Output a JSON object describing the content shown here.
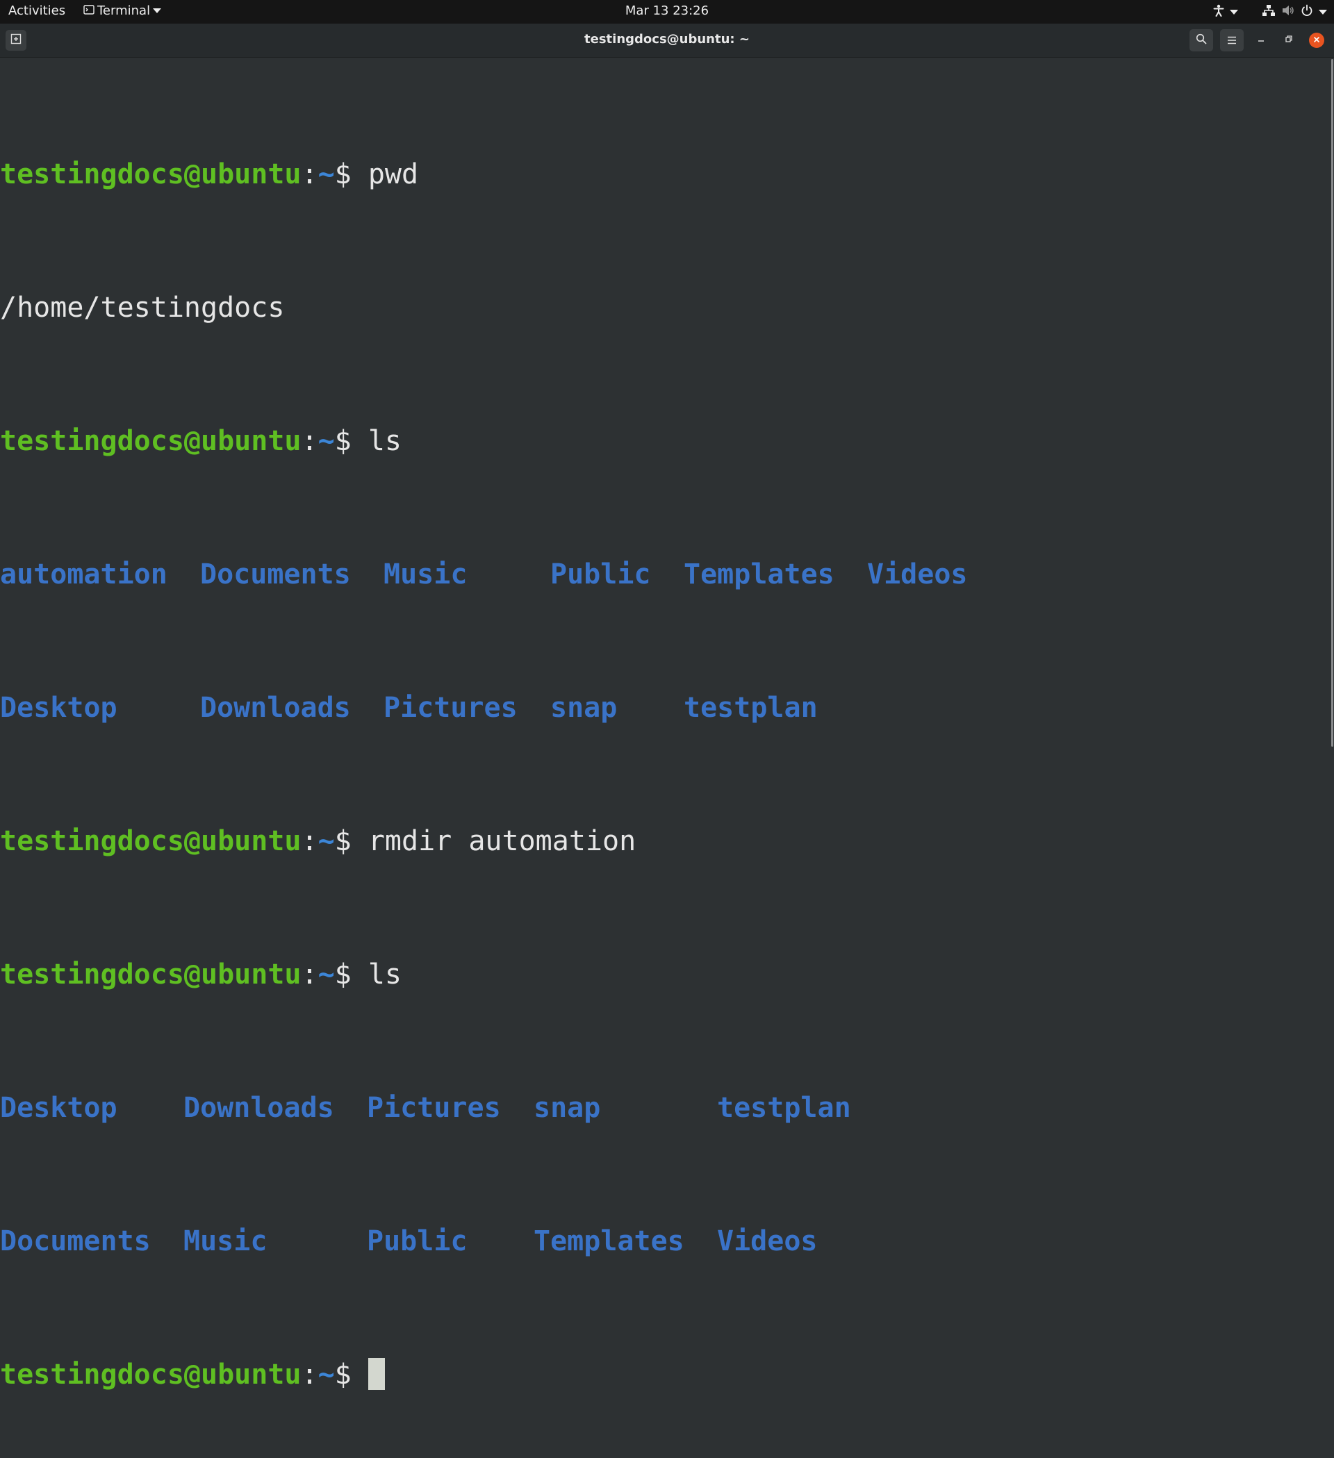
{
  "topbar": {
    "activities": "Activities",
    "app_menu_label": "Terminal",
    "clock": "Mar 13  23:26"
  },
  "window": {
    "title": "testingdocs@ubuntu: ~"
  },
  "prompt": {
    "user_host": "testingdocs@ubuntu",
    "colon": ":",
    "path": "~",
    "dollar": "$ "
  },
  "session": {
    "cmd1": "pwd",
    "out1": "/home/testingdocs",
    "cmd2": "ls",
    "ls1_row1": [
      "automation",
      "Documents",
      "Music",
      "Public",
      "Templates",
      "Videos"
    ],
    "ls1_row2": [
      "Desktop",
      "Downloads",
      "Pictures",
      "snap",
      "testplan"
    ],
    "cmd3": "rmdir automation",
    "cmd4": "ls",
    "ls2_row1": [
      "Desktop",
      "Downloads",
      "Pictures",
      "snap",
      "testplan"
    ],
    "ls2_row2": [
      "Documents",
      "Music",
      "Public",
      "Templates",
      "Videos"
    ]
  },
  "colors": {
    "prompt_user": "#5fbf22",
    "directory": "#3a73c8",
    "background": "#2d3133",
    "close_button": "#e95420"
  },
  "icons": {
    "app_menu": "terminal-icon",
    "accessibility": "accessibility-icon",
    "network": "network-icon",
    "volume": "volume-muted-icon",
    "power": "power-icon",
    "new_tab": "new-tab-icon",
    "search": "search-icon",
    "menu": "hamburger-menu-icon",
    "minimize": "minimize-icon",
    "restore": "restore-icon",
    "close": "close-icon"
  }
}
